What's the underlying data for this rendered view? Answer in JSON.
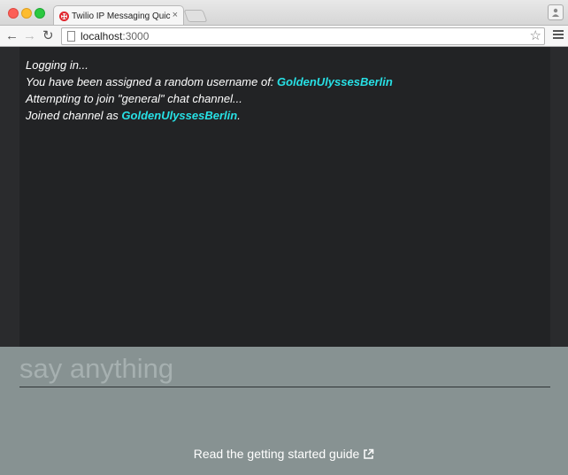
{
  "browser": {
    "tab_title": "Twilio IP Messaging Quick",
    "tab_close": "×",
    "url_host": "localhost",
    "url_port": ":3000",
    "icons": [
      "close-dot",
      "minimize-dot",
      "maximize-dot",
      "twilio-favicon",
      "back-arrow",
      "forward-arrow",
      "reload",
      "page-icon",
      "star",
      "menu",
      "profile"
    ]
  },
  "chat": {
    "messages": [
      {
        "text": "Logging in..."
      },
      {
        "prefix": "You have been assigned a random username of: ",
        "username": "GoldenUlyssesBerlin"
      },
      {
        "text": "Attempting to join \"general\" chat channel..."
      },
      {
        "prefix": "Joined channel as ",
        "username": "GoldenUlyssesBerlin",
        "suffix": "."
      }
    ],
    "input": {
      "placeholder": "say anything",
      "value": ""
    }
  },
  "footer": {
    "guide_label": "Read the getting started guide"
  },
  "colors": {
    "chat_bg": "#222325",
    "input_bg": "#879292",
    "username": "#27e0e5"
  }
}
